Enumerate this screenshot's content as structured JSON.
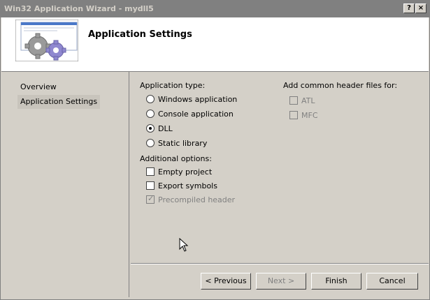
{
  "window": {
    "title": "Win32 Application Wizard - mydll5",
    "help_label": "?",
    "close_label": "×"
  },
  "banner": {
    "title": "Application Settings"
  },
  "nav": {
    "items": [
      {
        "label": "Overview"
      },
      {
        "label": "Application Settings"
      }
    ]
  },
  "app_type": {
    "label": "Application type:",
    "options": [
      {
        "label": "Windows application",
        "checked": false
      },
      {
        "label": "Console application",
        "checked": false
      },
      {
        "label": "DLL",
        "checked": true
      },
      {
        "label": "Static library",
        "checked": false
      }
    ]
  },
  "additional": {
    "label": "Additional options:",
    "options": [
      {
        "label": "Empty project",
        "checked": false,
        "enabled": true
      },
      {
        "label": "Export symbols",
        "checked": false,
        "enabled": true
      },
      {
        "label": "Precompiled header",
        "checked": true,
        "enabled": false
      }
    ]
  },
  "headers": {
    "label": "Add common header files for:",
    "options": [
      {
        "label": "ATL",
        "checked": false,
        "enabled": false
      },
      {
        "label": "MFC",
        "checked": false,
        "enabled": false
      }
    ]
  },
  "buttons": {
    "previous": "< Previous",
    "next": "Next >",
    "finish": "Finish",
    "cancel": "Cancel"
  },
  "colors": {
    "face": "#d4d0c8",
    "titlebar_inactive": "#808080",
    "disabled_text": "#808080"
  }
}
